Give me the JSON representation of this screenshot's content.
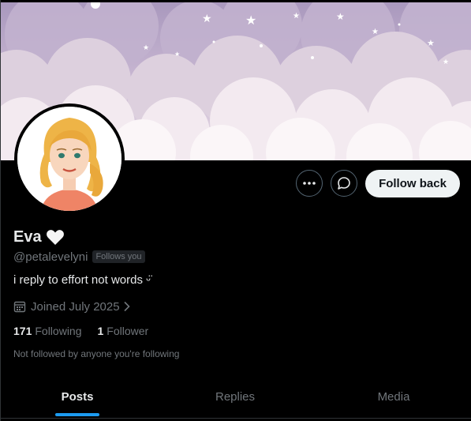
{
  "profile": {
    "name": "Eva",
    "handle": "@petalevelyni",
    "follows_you_badge": "Follows you",
    "bio": "i reply to effort not words ᵕ̈",
    "joined": "Joined July 2025",
    "following_count": "171",
    "following_label": "Following",
    "followers_count": "1",
    "followers_label": "Follower",
    "mutuals_note": "Not followed by anyone you're following"
  },
  "actions": {
    "more_icon": "more-horizontal-icon",
    "message_icon": "message-icon",
    "follow_label": "Follow back"
  },
  "tabs": [
    {
      "label": "Posts",
      "active": true
    },
    {
      "label": "Replies",
      "active": false
    },
    {
      "label": "Media",
      "active": false
    }
  ],
  "colors": {
    "accent": "#1d9bf0",
    "background": "#000000",
    "banner_sky": "#b9a9c9",
    "banner_clouds": "#f6eef2"
  }
}
